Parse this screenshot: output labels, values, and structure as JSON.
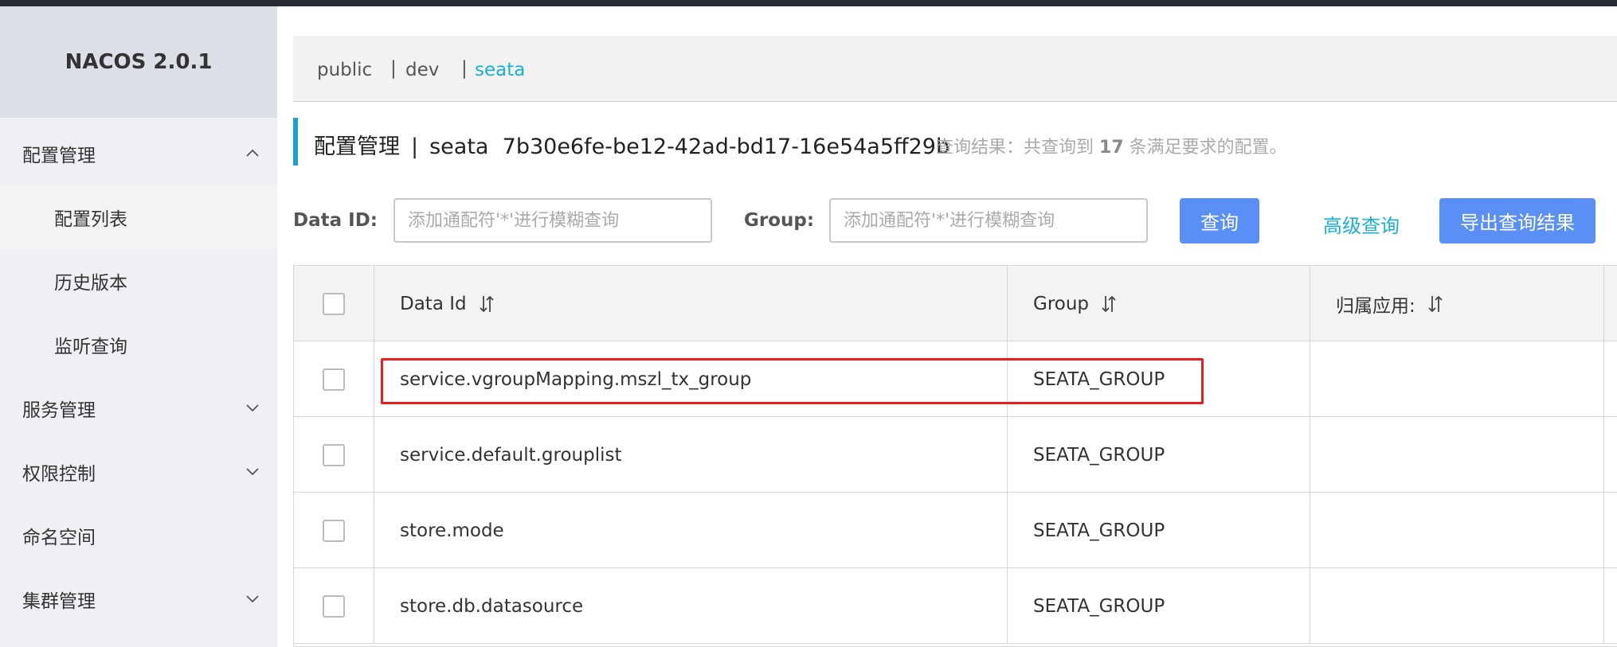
{
  "brand": "NACOS 2.0.1",
  "sidebar": {
    "items": [
      {
        "label": "配置管理"
      },
      {
        "label": "配置列表"
      },
      {
        "label": "历史版本"
      },
      {
        "label": "监听查询"
      },
      {
        "label": "服务管理"
      },
      {
        "label": "权限控制"
      },
      {
        "label": "命名空间"
      },
      {
        "label": "集群管理"
      }
    ]
  },
  "namespaces": {
    "separator": "|",
    "items": [
      {
        "label": "public"
      },
      {
        "label": "dev"
      },
      {
        "label": "seata",
        "active": true
      }
    ]
  },
  "header": {
    "title": "配置管理",
    "separator": "|",
    "namespace_name": "seata",
    "namespace_id": "7b30e6fe-be12-42ad-bd17-16e54a5ff29b",
    "result_prefix": "查询结果：共查询到",
    "result_count": "17",
    "result_suffix": "条满足要求的配置。"
  },
  "search": {
    "data_id_label": "Data ID:",
    "data_id_placeholder": "添加通配符'*'进行模糊查询",
    "group_label": "Group:",
    "group_placeholder": "添加通配符'*'进行模糊查询",
    "query_button": "查询",
    "advanced_link": "高级查询",
    "export_button": "导出查询结果"
  },
  "table": {
    "columns": [
      "Data Id",
      "Group",
      "归属应用:"
    ],
    "rows": [
      {
        "data_id": "service.vgroupMapping.mszl_tx_group",
        "group": "SEATA_GROUP",
        "app": ""
      },
      {
        "data_id": "service.default.grouplist",
        "group": "SEATA_GROUP",
        "app": ""
      },
      {
        "data_id": "store.mode",
        "group": "SEATA_GROUP",
        "app": ""
      },
      {
        "data_id": "store.db.datasource",
        "group": "SEATA_GROUP",
        "app": ""
      }
    ]
  },
  "colors": {
    "accent": "#1ab0d6",
    "primary_button": "#5a8ff5",
    "highlight_box": "#e61e1e",
    "topbar": "#262a31"
  },
  "icons": {
    "expand": "chevron-up-icon",
    "collapse": "chevron-down-icon",
    "sort": "sort-icon"
  }
}
